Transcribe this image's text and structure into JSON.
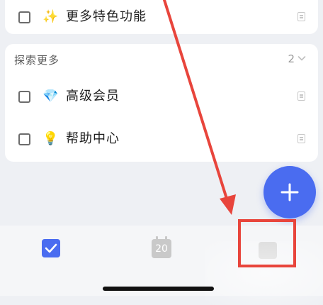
{
  "top_card": {
    "task": {
      "emoji": "✨",
      "text": "更多特色功能"
    }
  },
  "explore": {
    "title": "探索更多",
    "count": "2",
    "tasks": [
      {
        "emoji": "💎",
        "text": "高级会员"
      },
      {
        "emoji": "💡",
        "text": "帮助中心"
      }
    ]
  },
  "bottom_nav": {
    "calendar_day": "20"
  },
  "annotation": {
    "arrow_color": "#e8453c",
    "box_color": "#e8453c"
  },
  "colors": {
    "accent": "#4a6cf0",
    "background": "#eef0f4"
  }
}
